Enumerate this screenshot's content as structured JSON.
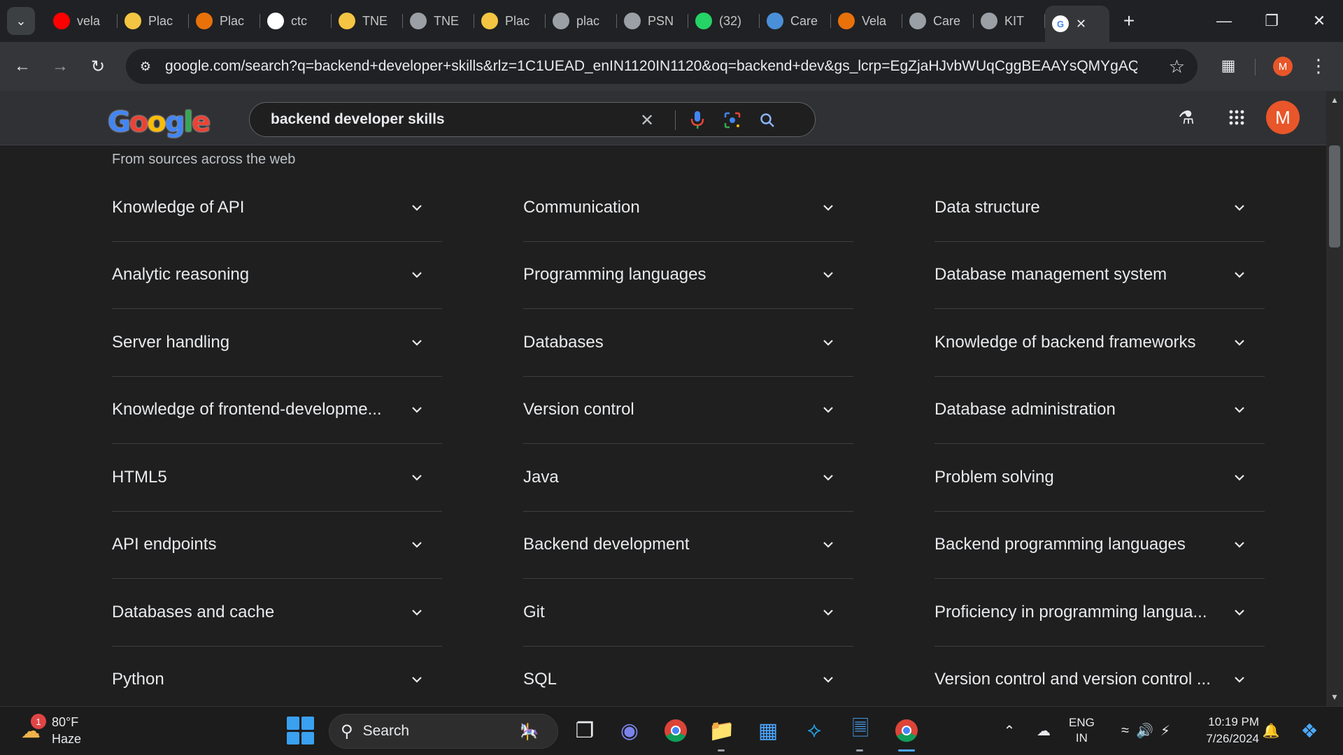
{
  "browser": {
    "tabs": [
      {
        "label": "vela",
        "icon": "youtube-icon",
        "color": "#ff0000"
      },
      {
        "label": "Plac",
        "icon": "flag-icon",
        "color": "#f4c542"
      },
      {
        "label": "Plac",
        "icon": "x-logo-icon",
        "color": "#e8710a"
      },
      {
        "label": "ctc",
        "icon": "google-icon",
        "color": "#ffffff"
      },
      {
        "label": "TNE",
        "icon": "emblem-icon",
        "color": "#f4c542"
      },
      {
        "label": "TNE",
        "icon": "globe-icon",
        "color": "#9aa0a6"
      },
      {
        "label": "Plac",
        "icon": "lotus-icon",
        "color": "#f4c542"
      },
      {
        "label": "plac",
        "icon": "globe-icon",
        "color": "#9aa0a6"
      },
      {
        "label": "PSN",
        "icon": "globe-icon",
        "color": "#9aa0a6"
      },
      {
        "label": "(32)",
        "icon": "whatsapp-icon",
        "color": "#25d366"
      },
      {
        "label": "Care",
        "icon": "document-icon",
        "color": "#4a90d9"
      },
      {
        "label": "Vela",
        "icon": "avatar-icon",
        "color": "#e8710a"
      },
      {
        "label": "Care",
        "icon": "spiral-icon",
        "color": "#9aa0a6"
      },
      {
        "label": "KIT",
        "icon": "emblem-icon",
        "color": "#9aa0a6"
      }
    ],
    "url": "google.com/search?q=backend+developer+skills&rlz=1C1UEAD_enIN1120IN1120&oq=backend+dev&gs_lcrp=EgZjaHJvbWUqCggBEAAYsQMYgAQy...",
    "profile_initial": "M"
  },
  "google": {
    "query": "backend developer skills",
    "avatar_initial": "M",
    "doodle_letters": [
      "G",
      "o",
      "o",
      "g",
      "l",
      "e"
    ]
  },
  "results": {
    "sources_label": "From sources across the web",
    "columns": [
      [
        "Knowledge of API",
        "Analytic reasoning",
        "Server handling",
        "Knowledge of frontend-developme...",
        "HTML5",
        "API endpoints",
        "Databases and cache",
        "Python"
      ],
      [
        "Communication",
        "Programming languages",
        "Databases",
        "Version control",
        "Java",
        "Backend development",
        "Git",
        "SQL"
      ],
      [
        "Data structure",
        "Database management system",
        "Knowledge of backend frameworks",
        "Database administration",
        "Problem solving",
        "Backend programming languages",
        "Proficiency in programming langua...",
        "Version control and version control ..."
      ]
    ]
  },
  "taskbar": {
    "weather_temp": "80°F",
    "weather_desc": "Haze",
    "weather_badge": "1",
    "search_label": "Search",
    "lang_line1": "ENG",
    "lang_line2": "IN",
    "time": "10:19 PM",
    "date": "7/26/2024"
  }
}
